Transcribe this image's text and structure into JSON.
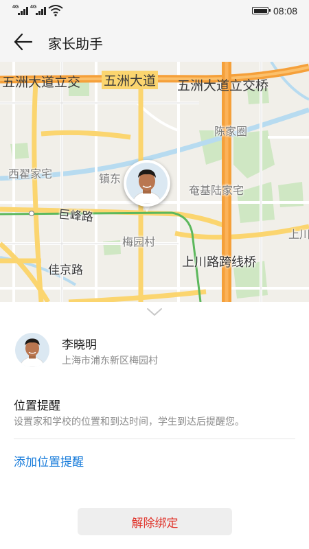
{
  "status_bar": {
    "signal_1_label": "4G",
    "signal_2_label": "4G",
    "time": "08:08",
    "icons": [
      "signal-icon",
      "signal-icon",
      "wifi-icon",
      "battery-icon"
    ]
  },
  "app_bar": {
    "back_icon": "arrow-left-icon",
    "title": "家长助手"
  },
  "map": {
    "labels": {
      "road_top_left": "五洲大道立交",
      "road_top_mid": "五洲大道",
      "road_top_right": "五洲大道立交桥",
      "chenjiaquan": "陈家圈",
      "xiqujiazhai": "西翟家宅",
      "zhendong": "镇东",
      "anjilujiazhai": "奄基陆家宅",
      "jufeng_road": "巨峰路",
      "meiyuancun": "梅园村",
      "shang_right": "上川",
      "shangchuan_bridge": "上川路跨线桥",
      "jiajing_road": "佳京路"
    },
    "colors": {
      "expressway": "#f5a03a",
      "main_road": "#fbd56f",
      "green": "#cfe7c3",
      "water": "#b7dbf0",
      "metro": "#5cb85c"
    }
  },
  "sheet": {
    "collapse_icon": "chevron-down-icon",
    "student": {
      "name": "李晓明",
      "address": "上海市浦东新区梅园村"
    },
    "reminder": {
      "title": "位置提醒",
      "description": "设置家和学校的位置和到达时间，学生到达后提醒您。",
      "add_label": "添加位置提醒"
    },
    "unbind_label": "解除绑定"
  }
}
